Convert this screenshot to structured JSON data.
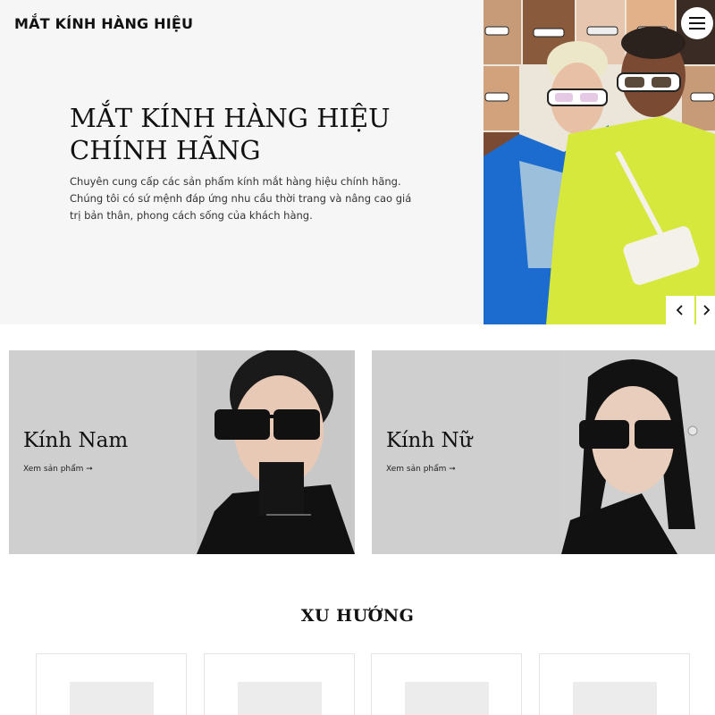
{
  "header": {
    "brand": "MẮT KÍNH HÀNG HIỆU",
    "menu_icon": "hamburger-menu-icon"
  },
  "hero": {
    "title_line1": "MẮT KÍNH HÀNG HIỆU",
    "title_line2": "CHÍNH HÃNG",
    "description": "Chuyên cung cấp các sản phẩm kính mắt hàng hiệu chính hãng. Chúng tôi có sứ mệnh đáp ứng nhu cầu thời trang và nâng cao giá trị bản thân, phong cách sống của khách hàng.",
    "prev_icon": "chevron-left-icon",
    "next_icon": "chevron-right-icon"
  },
  "categories": [
    {
      "title": "Kính Nam",
      "link": "Xem sản phẩm ➞"
    },
    {
      "title": "Kính Nữ",
      "link": "Xem sản phẩm ➞"
    }
  ],
  "trending": {
    "title": "XU HƯỚNG"
  },
  "colors": {
    "hero_bg": "#f6f6f6",
    "card_bg": "#cfcfcf",
    "text": "#111111",
    "accent_yellow": "#d7e83c",
    "accent_blue": "#1a6fd1"
  }
}
